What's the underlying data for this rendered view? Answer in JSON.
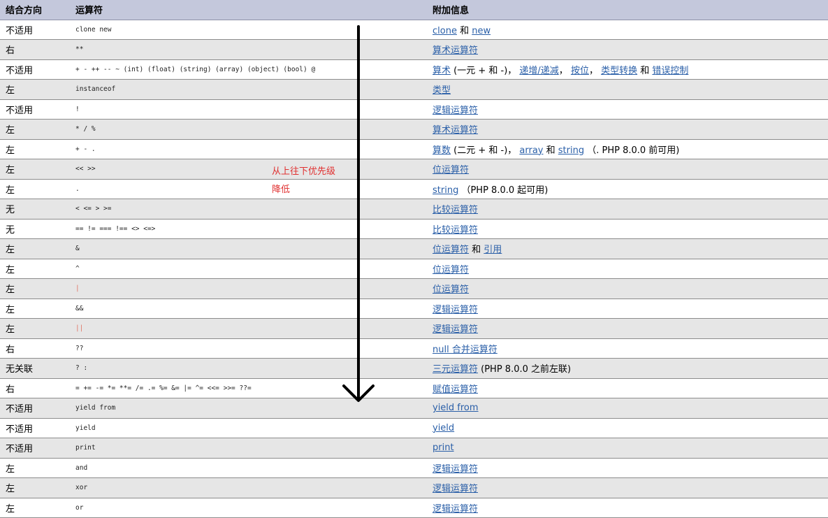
{
  "headers": [
    "结合方向",
    "运算符",
    "附加信息"
  ],
  "rows": [
    {
      "assoc": "不适用",
      "ops": "clone new",
      "info": [
        {
          "t": "clone",
          "link": true
        },
        {
          "t": " 和 "
        },
        {
          "t": "new",
          "link": true
        }
      ]
    },
    {
      "assoc": "右",
      "ops": "**",
      "info": [
        {
          "t": "算术运算符",
          "link": true
        }
      ]
    },
    {
      "assoc": "不适用",
      "ops": "+ - ++ -- ~ (int) (float) (string) (array) (object) (bool) @",
      "info": [
        {
          "t": "算术",
          "link": true
        },
        {
          "t": " (一元 + 和 -)， "
        },
        {
          "t": "递增/递减",
          "link": true
        },
        {
          "t": "， "
        },
        {
          "t": "按位",
          "link": true
        },
        {
          "t": "， "
        },
        {
          "t": "类型转换",
          "link": true
        },
        {
          "t": " 和 "
        },
        {
          "t": "错误控制",
          "link": true
        }
      ]
    },
    {
      "assoc": "左",
      "ops": "instanceof",
      "info": [
        {
          "t": "类型",
          "link": true
        }
      ]
    },
    {
      "assoc": "不适用",
      "ops": "!",
      "info": [
        {
          "t": "逻辑运算符",
          "link": true
        }
      ]
    },
    {
      "assoc": "左",
      "ops": "* / %",
      "info": [
        {
          "t": "算术运算符",
          "link": true
        }
      ]
    },
    {
      "assoc": "左",
      "ops": "+ - .",
      "info": [
        {
          "t": "算数",
          "link": true
        },
        {
          "t": " (二元 + 和 -)， "
        },
        {
          "t": "array",
          "link": true
        },
        {
          "t": " 和 "
        },
        {
          "t": "string",
          "link": true
        },
        {
          "t": " （. PHP 8.0.0 前可用)"
        }
      ]
    },
    {
      "assoc": "左",
      "ops": "<< >>",
      "info": [
        {
          "t": "位运算符",
          "link": true
        }
      ]
    },
    {
      "assoc": "左",
      "ops": ".",
      "info": [
        {
          "t": "string",
          "link": true
        },
        {
          "t": " （PHP 8.0.0 起可用)"
        }
      ]
    },
    {
      "assoc": "无",
      "ops": "< <= > >=",
      "info": [
        {
          "t": "比较运算符",
          "link": true
        }
      ]
    },
    {
      "assoc": "无",
      "ops": "== != === !== <> <=>",
      "info": [
        {
          "t": "比较运算符",
          "link": true
        }
      ]
    },
    {
      "assoc": "左",
      "ops": "&",
      "info": [
        {
          "t": "位运算符",
          "link": true
        },
        {
          "t": " 和 "
        },
        {
          "t": "引用",
          "link": true
        }
      ]
    },
    {
      "assoc": "左",
      "ops": "^",
      "info": [
        {
          "t": "位运算符",
          "link": true
        }
      ]
    },
    {
      "assoc": "左",
      "ops": "|",
      "pipe": true,
      "info": [
        {
          "t": "位运算符",
          "link": true
        }
      ]
    },
    {
      "assoc": "左",
      "ops": "&&",
      "info": [
        {
          "t": "逻辑运算符",
          "link": true
        }
      ]
    },
    {
      "assoc": "左",
      "ops": "||",
      "pipe": true,
      "info": [
        {
          "t": "逻辑运算符",
          "link": true
        }
      ]
    },
    {
      "assoc": "右",
      "ops": "??",
      "info": [
        {
          "t": "null 合并运算符",
          "link": true
        }
      ]
    },
    {
      "assoc": "无关联",
      "ops": "? :",
      "info": [
        {
          "t": "三元运算符",
          "link": true
        },
        {
          "t": " (PHP 8.0.0 之前左联)"
        }
      ]
    },
    {
      "assoc": "右",
      "ops": "= += -= *= **= /= .= %= &= |= ^= <<= >>= ??=",
      "info": [
        {
          "t": "赋值运算符",
          "link": true
        }
      ]
    },
    {
      "assoc": "不适用",
      "ops": "yield from",
      "info": [
        {
          "t": "yield from",
          "link": true
        }
      ]
    },
    {
      "assoc": "不适用",
      "ops": "yield",
      "info": [
        {
          "t": "yield",
          "link": true
        }
      ]
    },
    {
      "assoc": "不适用",
      "ops": "print",
      "info": [
        {
          "t": "print",
          "link": true
        }
      ]
    },
    {
      "assoc": "左",
      "ops": "and",
      "info": [
        {
          "t": "逻辑运算符",
          "link": true
        }
      ]
    },
    {
      "assoc": "左",
      "ops": "xor",
      "info": [
        {
          "t": "逻辑运算符",
          "link": true
        }
      ]
    },
    {
      "assoc": "左",
      "ops": "or",
      "info": [
        {
          "t": "逻辑运算符",
          "link": true
        }
      ]
    }
  ],
  "annotation": {
    "line1": "从上往下优先级",
    "line2": "降低"
  },
  "colors": {
    "link": "#2a5fa8",
    "header_bg": "#c4c8dc",
    "stripe": "#e6e6e6",
    "annotation": "#e03030",
    "arrow": "#000000"
  }
}
